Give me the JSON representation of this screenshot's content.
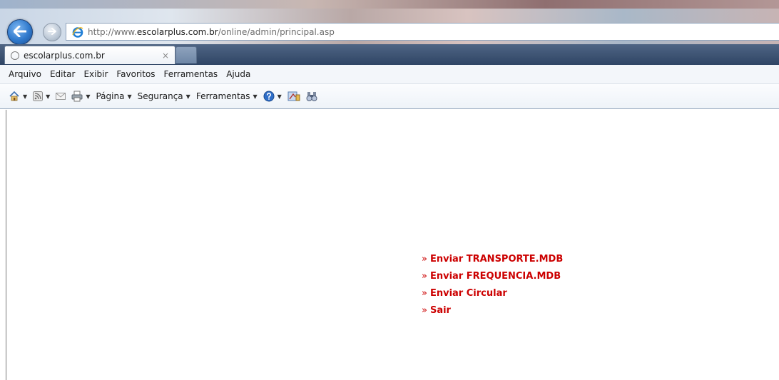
{
  "browser": {
    "address": {
      "url_prefix": "http://www.",
      "url_domain": "escolarplus.com.br",
      "url_path": "/online/admin/principal.asp"
    },
    "tab": {
      "title": "escolarplus.com.br",
      "close_glyph": "×"
    },
    "icons": {
      "back": "arrow-left-icon",
      "forward": "arrow-right-icon",
      "site": "ie-logo-icon",
      "loading": "loading-circle-icon"
    }
  },
  "menubar": {
    "items": [
      "Arquivo",
      "Editar",
      "Exibir",
      "Favoritos",
      "Ferramentas",
      "Ajuda"
    ]
  },
  "commandbar": {
    "pagina": "Página",
    "seguranca": "Segurança",
    "ferramentas": "Ferramentas",
    "dropdown_glyph": "▼"
  },
  "page": {
    "link_prefix": "»",
    "links": [
      "Enviar TRANSPORTE.MDB",
      "Enviar FREQUENCIA.MDB",
      "Enviar Circular",
      "Sair"
    ],
    "link_color": "#cc0000"
  }
}
